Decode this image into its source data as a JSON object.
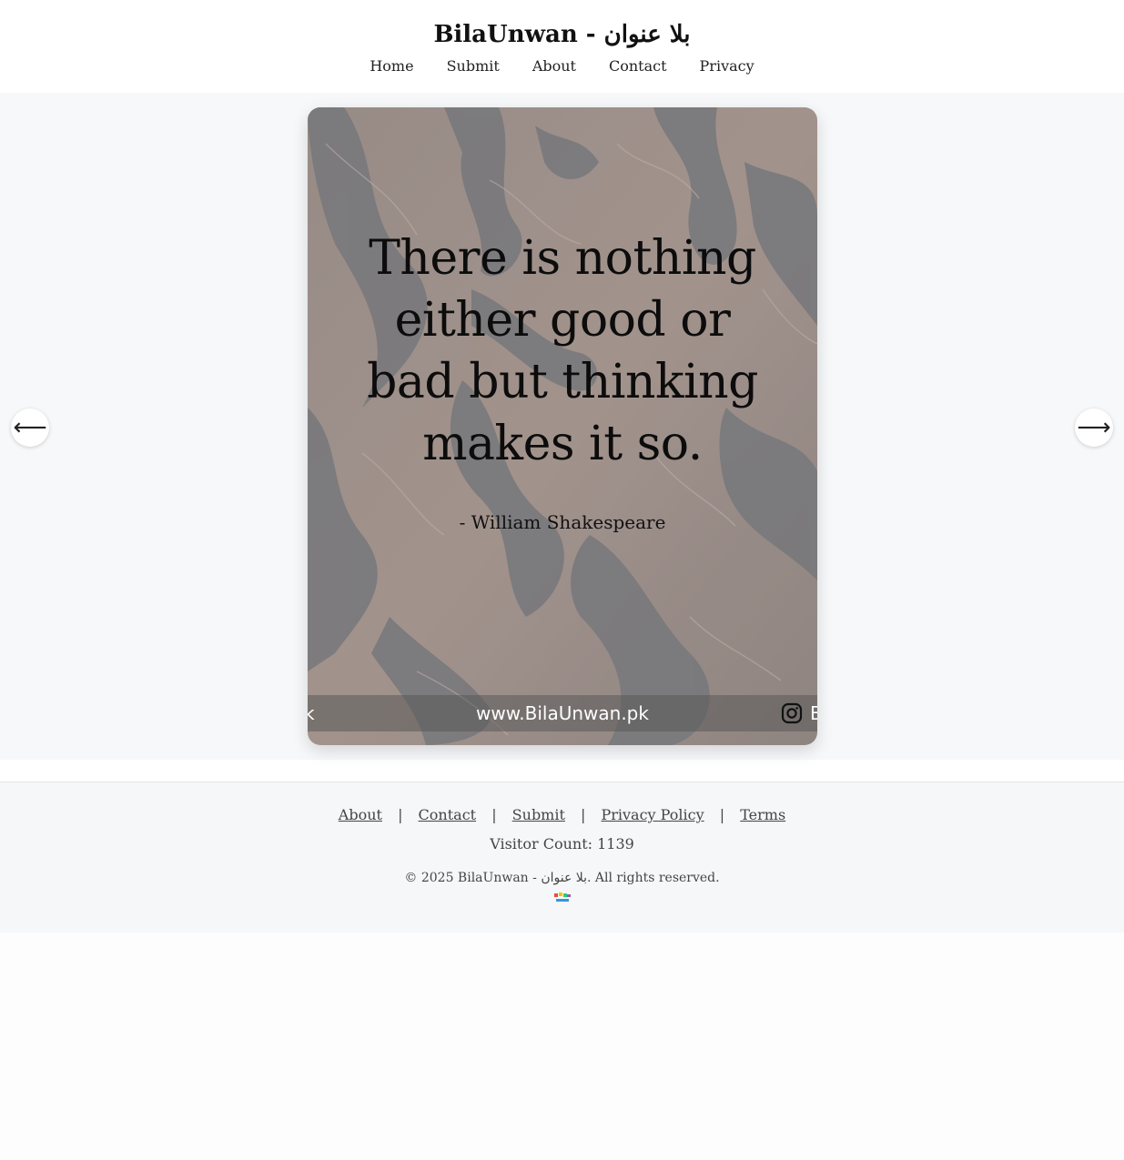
{
  "header": {
    "title": "BilaUnwan - بلا عنوان",
    "nav": [
      "Home",
      "Submit",
      "About",
      "Contact",
      "Privacy"
    ]
  },
  "carousel": {
    "quote": "There is nothing either good or bad but thinking makes it so.",
    "author": "- William Shakespeare",
    "watermark": {
      "left_fragment": "k",
      "center": "www.BilaUnwan.pk",
      "right_fragment": "B",
      "right_icon": "instagram-icon"
    },
    "prev_icon": "⟵",
    "next_icon": "⟶"
  },
  "footer": {
    "links": [
      "About",
      "Contact",
      "Submit",
      "Privacy Policy",
      "Terms"
    ],
    "separator": "|",
    "visitor_count": "Visitor Count: 1139",
    "copyright": "© 2025 BilaUnwan - بلا عنوان. All rights reserved.",
    "logo_icon": "bilaunwan-logo-icon"
  },
  "colors": {
    "page_bg": "#fdfdfd",
    "carousel_bg": "#f7f8fa",
    "footer_bg": "#f6f7f9",
    "text": "#222222",
    "link": "#444444"
  }
}
